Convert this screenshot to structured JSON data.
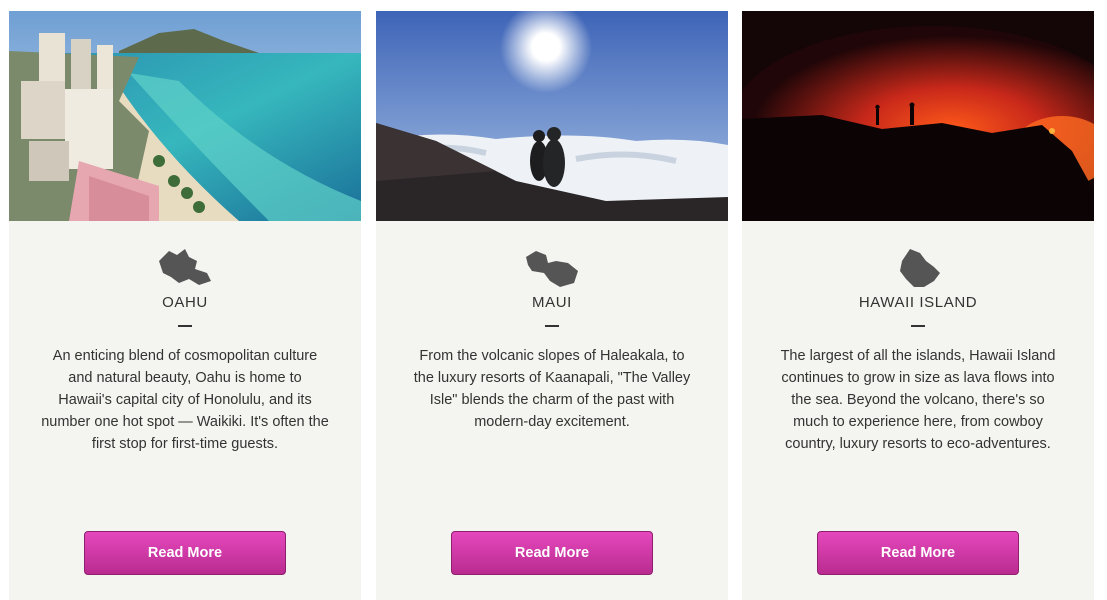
{
  "cards": [
    {
      "name": "OAHU",
      "description": "An enticing blend of cosmopolitan culture and natural beauty, Oahu is home to Hawaii's capital city of Honolulu, and its number one hot spot — Waikiki. It's often the first stop for first-time guests.",
      "button_label": "Read More",
      "icon": "oahu-island-icon"
    },
    {
      "name": "MAUI",
      "description": "From the volcanic slopes of Haleakala, to the luxury resorts of Kaanapali, \"The Valley Isle\" blends the charm of the past with modern-day excitement.",
      "button_label": "Read More",
      "icon": "maui-island-icon"
    },
    {
      "name": "HAWAII ISLAND",
      "description": "The largest of all the islands, Hawaii Island continues to grow in size as lava flows into the sea. Beyond the volcano, there's so much to experience here, from cowboy country, luxury resorts to eco-adventures.",
      "button_label": "Read More",
      "icon": "hawaii-island-icon"
    }
  ],
  "colors": {
    "card_bg": "#f4f4f0",
    "button_top": "#e548bd",
    "button_bottom": "#b92b8f",
    "text": "#333333",
    "icon": "#555555"
  }
}
